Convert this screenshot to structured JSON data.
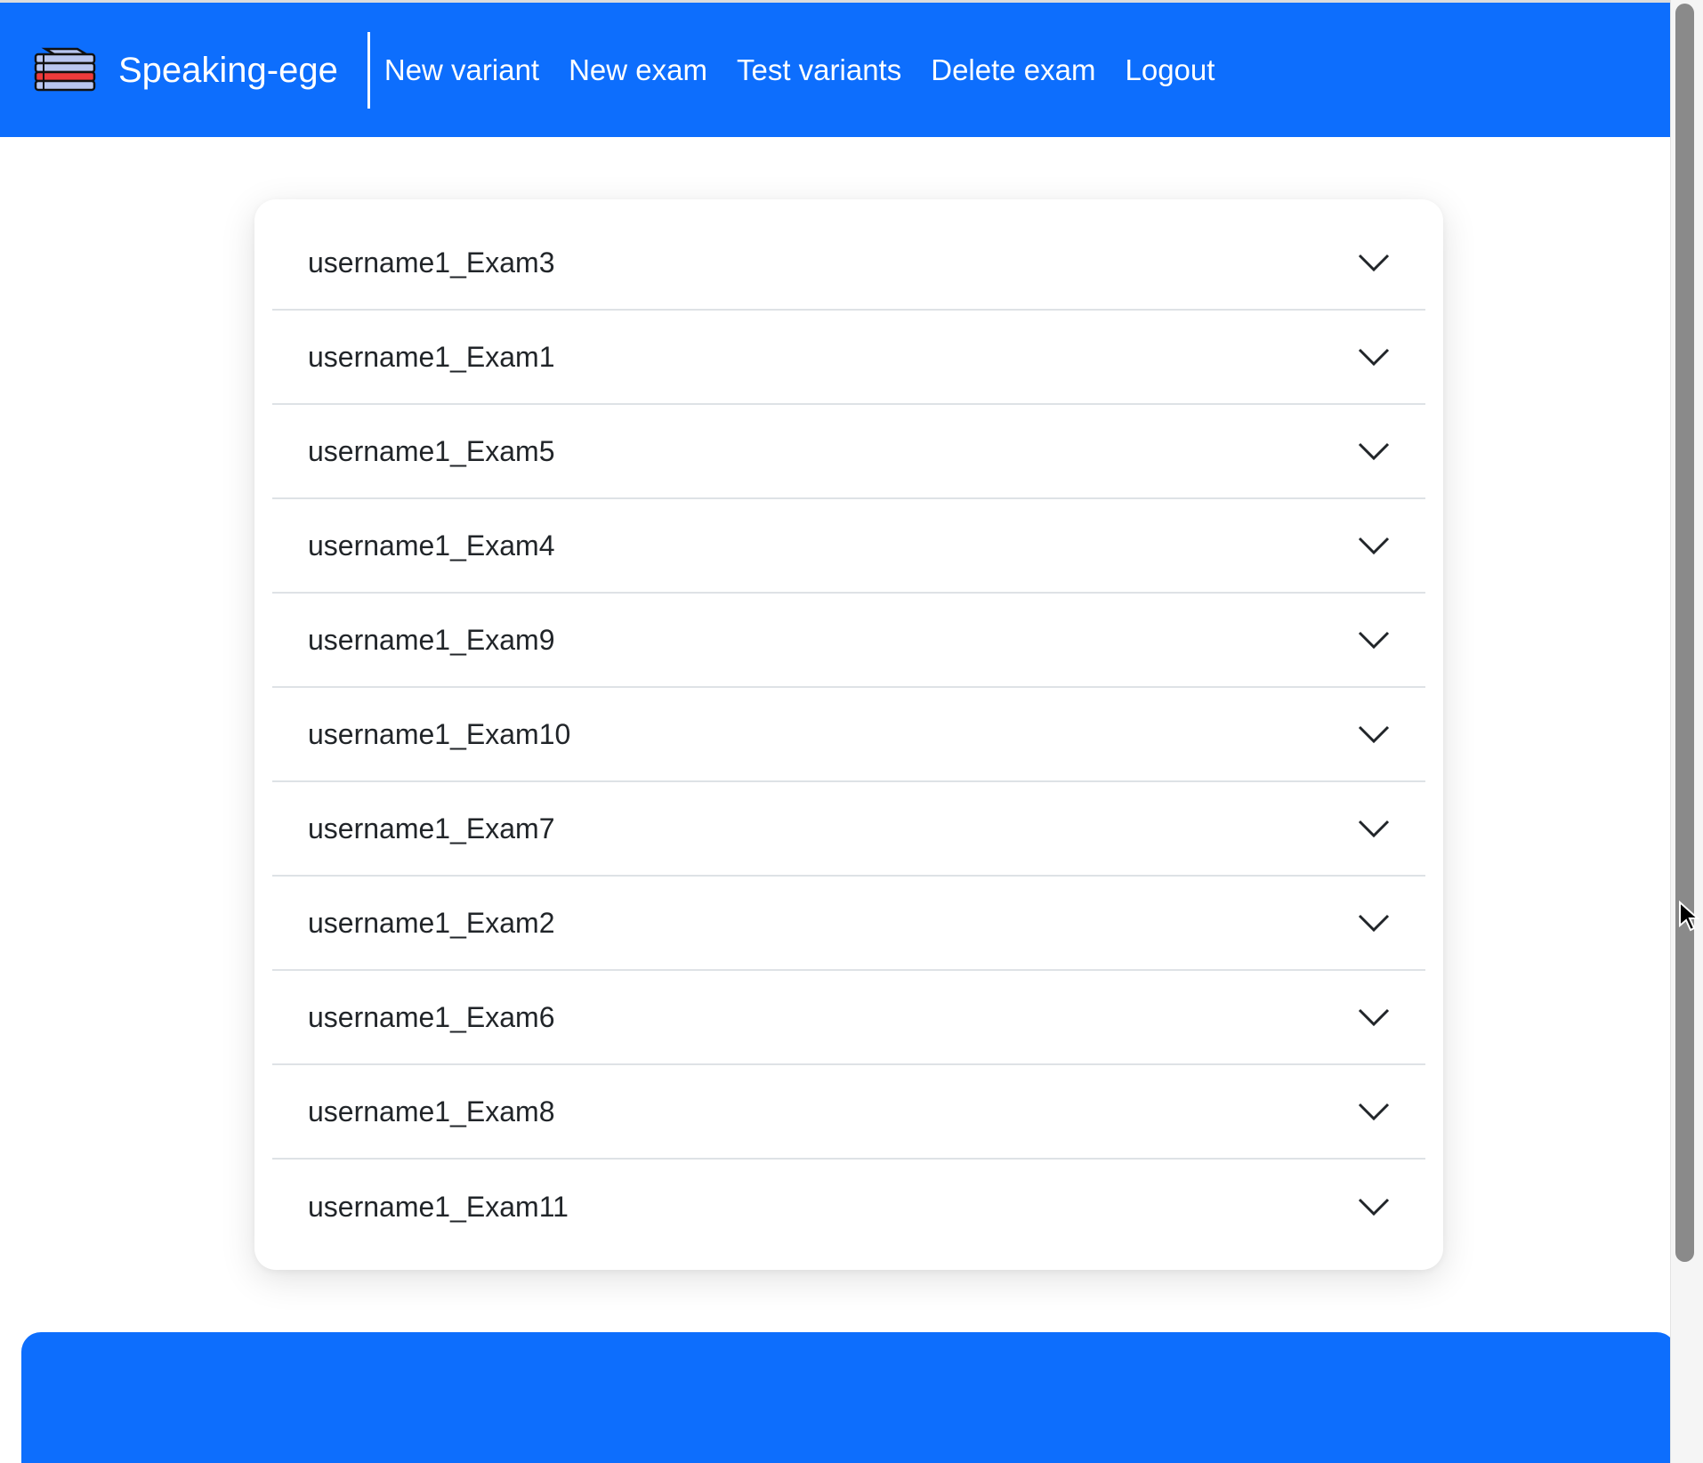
{
  "navbar": {
    "brand": "Speaking-ege",
    "links": [
      "New variant",
      "New exam",
      "Test variants",
      "Delete exam",
      "Logout"
    ]
  },
  "exams": [
    "username1_Exam3",
    "username1_Exam1",
    "username1_Exam5",
    "username1_Exam4",
    "username1_Exam9",
    "username1_Exam10",
    "username1_Exam7",
    "username1_Exam2",
    "username1_Exam6",
    "username1_Exam8",
    "username1_Exam11"
  ],
  "icons": {
    "logo": "stacked-books-icon",
    "expand": "chevron-down-icon"
  },
  "colors": {
    "primary": "#0d6efd",
    "text": "#212529",
    "divider": "#dee2e6"
  }
}
